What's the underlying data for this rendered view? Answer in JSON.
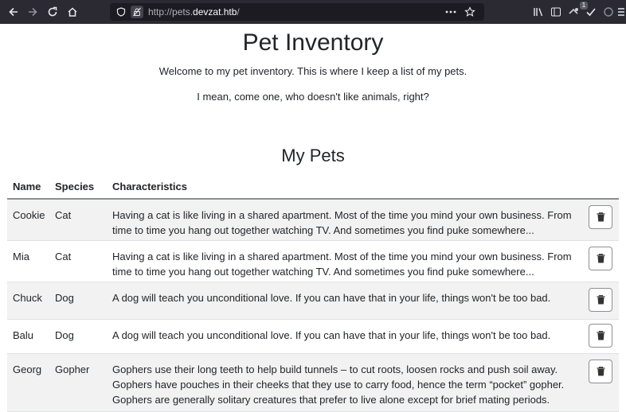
{
  "browser": {
    "url_prefix": "http://pets.",
    "url_domain": "devzat.htb",
    "url_suffix": "/",
    "notification_count": "1"
  },
  "page": {
    "title": "Pet Inventory",
    "intro_line1": "Welcome to my pet inventory. This is where I keep a list of my pets.",
    "intro_line2": "I mean, come one, who doesn't like animals, right?",
    "section_title": "My Pets"
  },
  "table": {
    "headers": {
      "name": "Name",
      "species": "Species",
      "characteristics": "Characteristics"
    },
    "rows": [
      {
        "name": "Cookie",
        "species": "Cat",
        "characteristics": "Having a cat is like living in a shared apartment. Most of the time you mind your own business. From time to time you hang out together watching TV. And sometimes you find puke somewhere..."
      },
      {
        "name": "Mia",
        "species": "Cat",
        "characteristics": "Having a cat is like living in a shared apartment. Most of the time you mind your own business. From time to time you hang out together watching TV. And sometimes you find puke somewhere..."
      },
      {
        "name": "Chuck",
        "species": "Dog",
        "characteristics": "A dog will teach you unconditional love. If you can have that in your life, things won't be too bad."
      },
      {
        "name": "Balu",
        "species": "Dog",
        "characteristics": "A dog will teach you unconditional love. If you can have that in your life, things won't be too bad."
      },
      {
        "name": "Georg",
        "species": "Gopher",
        "characteristics": "Gophers use their long teeth to help build tunnels – to cut roots, loosen rocks and push soil away. Gophers have pouches in their cheeks that they use to carry food, hence the term “pocket” gopher. Gophers are generally solitary creatures that prefer to live alone except for brief mating periods."
      }
    ]
  },
  "icons": {
    "delete": "trash-icon",
    "back": "back-arrow-icon",
    "forward": "forward-arrow-icon",
    "reload": "reload-icon",
    "home": "home-icon"
  },
  "colors": {
    "browser_chrome": "#2b2a33",
    "url_field": "#1c1b22",
    "striped_row": "#f2f2f2",
    "text": "#212529"
  }
}
